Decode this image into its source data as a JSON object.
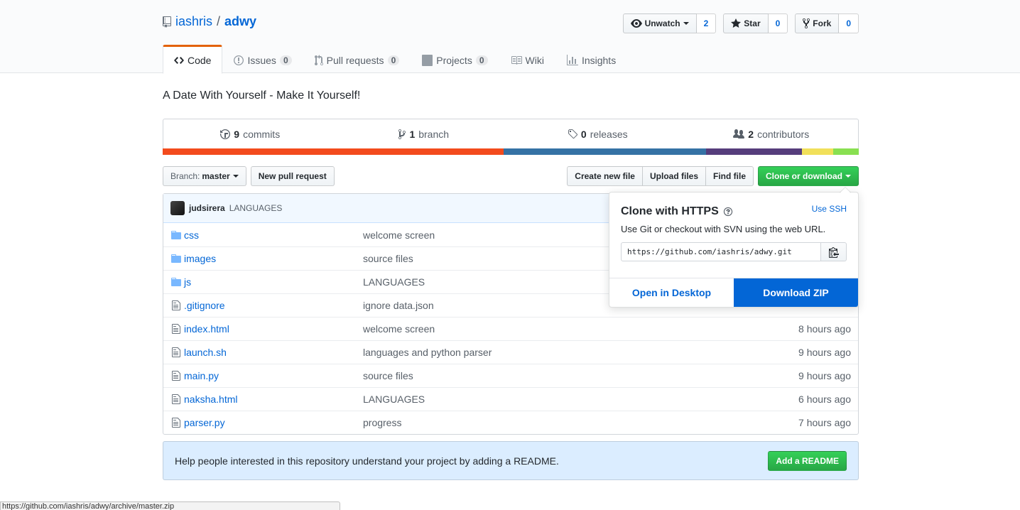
{
  "repo": {
    "owner": "iashris",
    "separator": "/",
    "name": "adwy"
  },
  "actions": {
    "watch_label": "Unwatch",
    "watch_count": "2",
    "star_label": "Star",
    "star_count": "0",
    "fork_label": "Fork",
    "fork_count": "0"
  },
  "nav": {
    "tabs": [
      {
        "label": "Code",
        "icon": "code-icon"
      },
      {
        "label": "Issues",
        "count": "0",
        "icon": "issue-icon"
      },
      {
        "label": "Pull requests",
        "count": "0",
        "icon": "pull-request-icon"
      },
      {
        "label": "Projects",
        "count": "0",
        "icon": "project-icon"
      },
      {
        "label": "Wiki",
        "icon": "book-icon"
      },
      {
        "label": "Insights",
        "icon": "graph-icon"
      }
    ]
  },
  "description": "A Date With Yourself - Make It Yourself!",
  "summary": {
    "commits_count": "9",
    "commits_label": "commits",
    "branch_count": "1",
    "branch_label": "branch",
    "releases_count": "0",
    "releases_label": "releases",
    "contributors_count": "2",
    "contributors_label": "contributors"
  },
  "language_bar": [
    {
      "color": "#f34b1d",
      "fraction": 0.49
    },
    {
      "color": "#3572a5",
      "fraction": 0.291
    },
    {
      "color": "#563d7c",
      "fraction": 0.137
    },
    {
      "color": "#f1e05a",
      "fraction": 0.045
    },
    {
      "color": "#89e051",
      "fraction": 0.037
    }
  ],
  "toolbar": {
    "branch_prefix": "Branch:",
    "branch_name": "master",
    "new_pr": "New pull request",
    "create_file": "Create new file",
    "upload_files": "Upload files",
    "find_file": "Find file",
    "clone_download": "Clone or download"
  },
  "commit": {
    "author": "judsirera",
    "message": "LANGUAGES"
  },
  "files": [
    {
      "type": "dir",
      "name": "css",
      "message": "welcome screen",
      "age": ""
    },
    {
      "type": "dir",
      "name": "images",
      "message": "source files",
      "age": ""
    },
    {
      "type": "dir",
      "name": "js",
      "message": "LANGUAGES",
      "age": ""
    },
    {
      "type": "file",
      "name": ".gitignore",
      "message": "ignore data.json",
      "age": ""
    },
    {
      "type": "file",
      "name": "index.html",
      "message": "welcome screen",
      "age": "8 hours ago"
    },
    {
      "type": "file",
      "name": "launch.sh",
      "message": "languages and python parser",
      "age": "9 hours ago"
    },
    {
      "type": "file",
      "name": "main.py",
      "message": "source files",
      "age": "9 hours ago"
    },
    {
      "type": "file",
      "name": "naksha.html",
      "message": "LANGUAGES",
      "age": "6 hours ago"
    },
    {
      "type": "file",
      "name": "parser.py",
      "message": "progress",
      "age": "7 hours ago"
    }
  ],
  "readme_banner": {
    "text": "Help people interested in this repository understand your project by adding a README.",
    "button": "Add a README"
  },
  "clone": {
    "title": "Clone with HTTPS",
    "use_ssh": "Use SSH",
    "help": "Use Git or checkout with SVN using the web URL.",
    "url": "https://github.com/iashris/adwy.git",
    "open_desktop": "Open in Desktop",
    "download_zip": "Download ZIP"
  },
  "status_url": "https://github.com/iashris/adwy/archive/master.zip",
  "colors": {
    "link": "#0366d6",
    "primary_green": "#28a745",
    "accent_orange": "#e36209"
  }
}
